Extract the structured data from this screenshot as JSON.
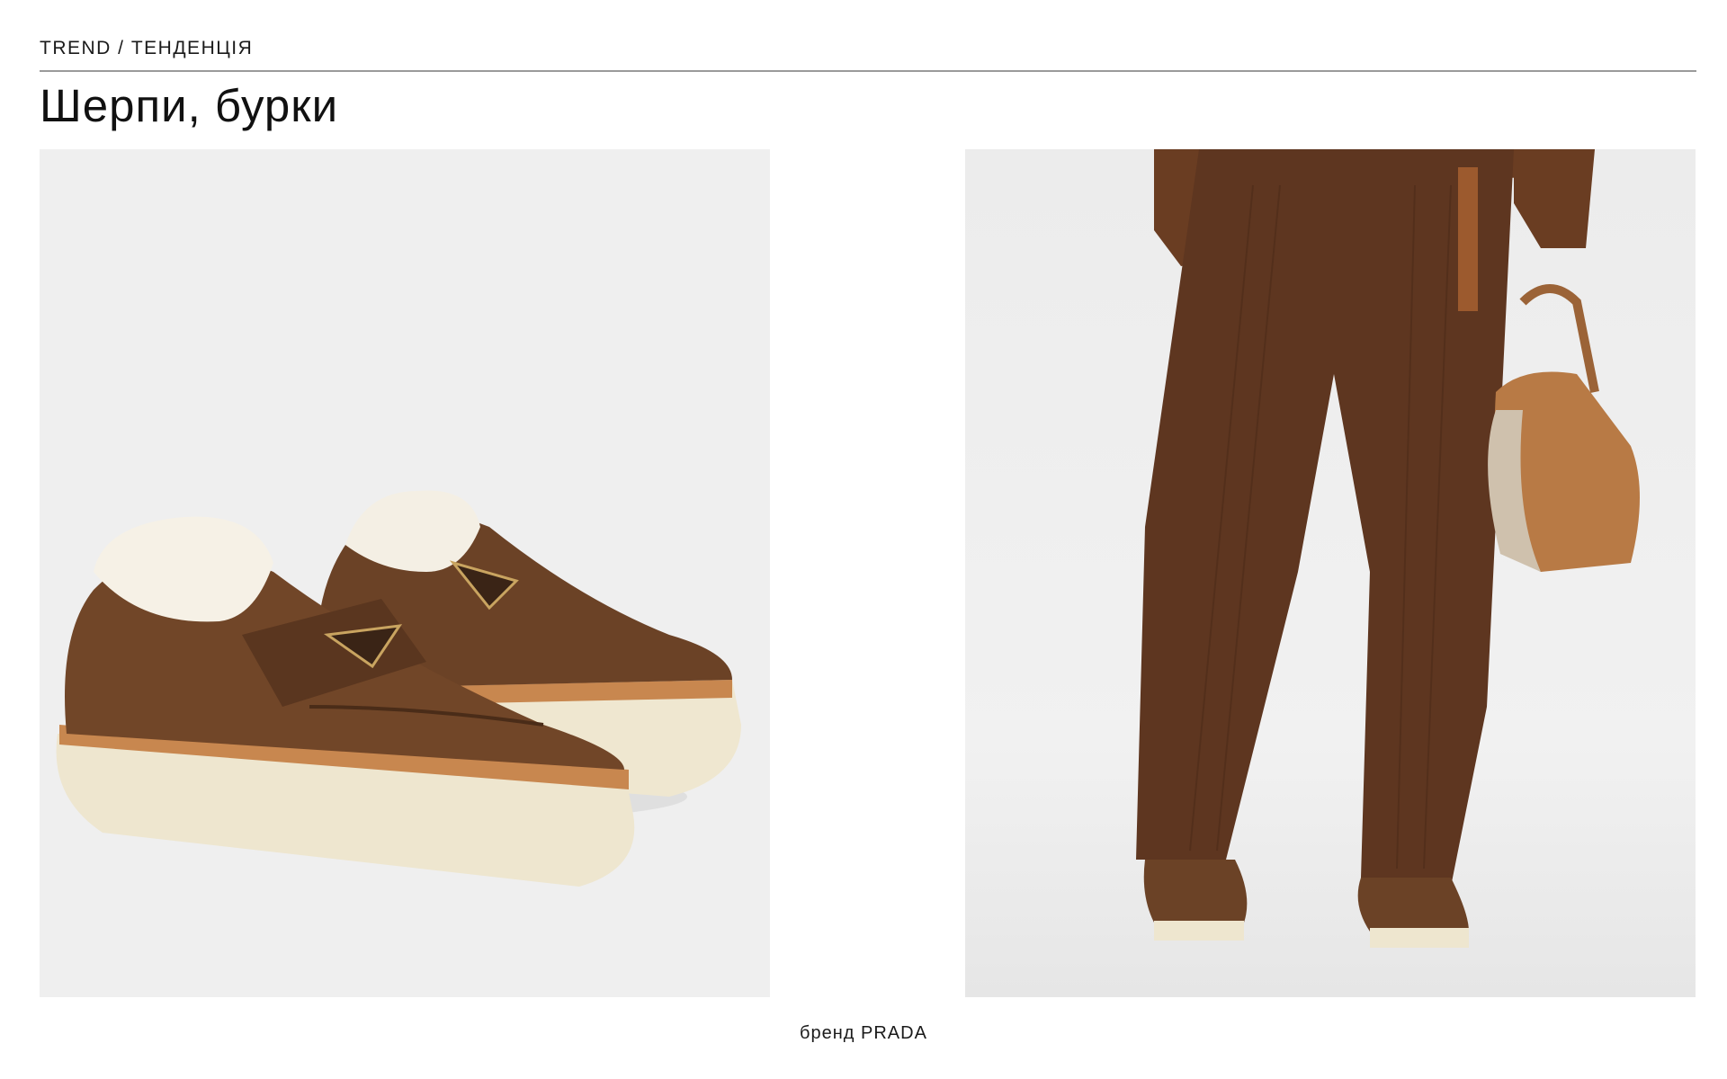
{
  "header": {
    "eyebrow": "TREND / ТЕНДЕНЦІЯ",
    "title": "Шерпи, бурки"
  },
  "images": {
    "left": {
      "subject": "pair of brown suede platform loafers with shearling lining",
      "logo_text": "PRADA"
    },
    "right": {
      "subject": "model in brown corduroy trousers and jacket holding tan leather bag, wearing the loafers"
    }
  },
  "caption": "бренд PRADA",
  "colors": {
    "suede": "#6b4226",
    "shearling": "#f4efe4",
    "sole": "#eee6cf",
    "welt": "#c8874f",
    "corduroy": "#5e3620",
    "bag": "#b87a45"
  }
}
